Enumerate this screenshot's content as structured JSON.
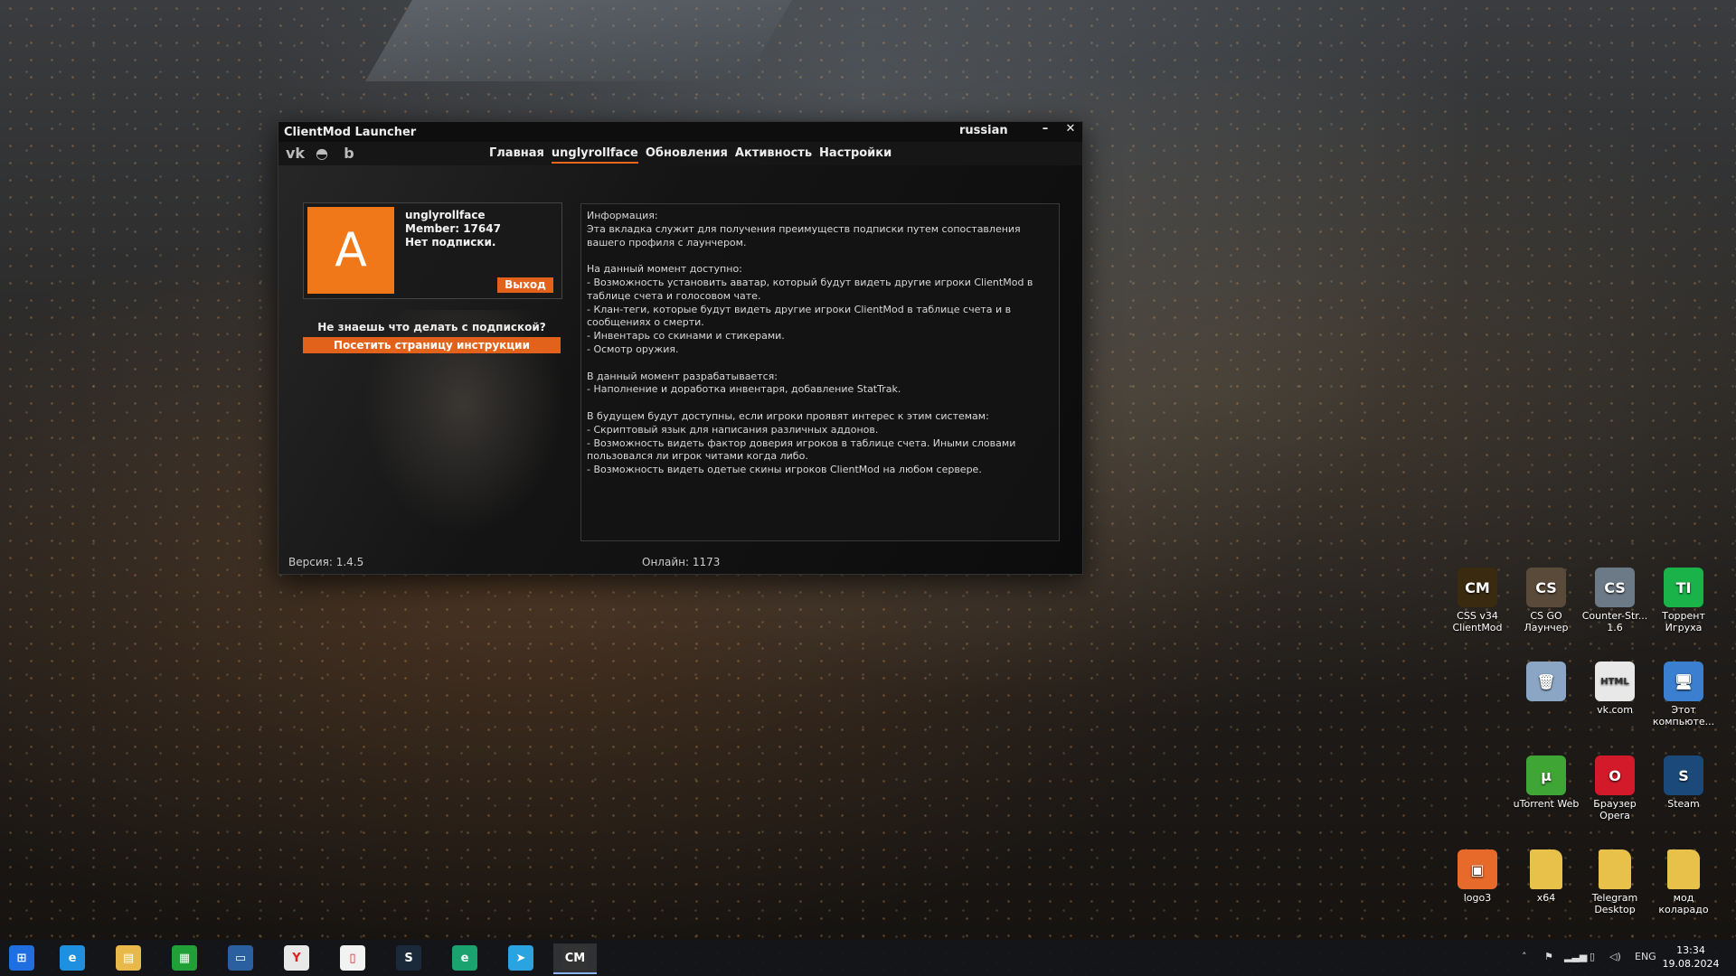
{
  "window": {
    "title": "ClientMod Launcher",
    "language": "russian",
    "minimize_glyph": "–",
    "close_glyph": "✕"
  },
  "social": [
    {
      "icon": "vk-icon",
      "glyph": "vk"
    },
    {
      "icon": "discord-icon",
      "glyph": "◓"
    },
    {
      "icon": "b-logo-icon",
      "glyph": "b"
    }
  ],
  "tabs": [
    {
      "label": "Главная"
    },
    {
      "label": "unglyrollface"
    },
    {
      "label": "Обновления"
    },
    {
      "label": "Активность"
    },
    {
      "label": "Настройки"
    }
  ],
  "profile": {
    "avatar_letter": "A",
    "username": "unglyrollface",
    "member": "Member: 17647",
    "subscription": "Нет подписки.",
    "logout_label": "Выход"
  },
  "help": {
    "question": "Не знаешь что делать с подпиской?",
    "button_label": "Посетить страницу инструкции"
  },
  "info": {
    "text": "Информация:\nЭта вкладка служит для получения преимуществ подписки путем сопоставления вашего профиля с лаунчером.\n\nНа данный момент доступно:\n- Возможность установить аватар, который будут видеть другие игроки ClientMod в таблице счета и голосовом чате.\n- Клан-теги, которые будут видеть другие игроки ClientMod в таблице счета и в сообщениях о смерти.\n- Инвентарь со скинами и стикерами.\n- Осмотр оружия.\n\nВ данный момент разрабатывается:\n- Наполнение и доработка инвентаря, добавление StatTrak.\n\nВ будущем будут доступны, если игроки проявят интерес к этим системам:\n- Скриптовый язык для написания различных аддонов.\n- Возможность видеть фактор доверия игроков в таблице счета. Иными словами пользовался ли игрок читами когда либо.\n- Возможность видеть одетые скины игроков ClientMod на любом сервере."
  },
  "footer": {
    "version": "Версия: 1.4.5",
    "online": "Онлайн: 1173"
  },
  "desktop_icons": [
    {
      "label": "CSS v34 ClientMod",
      "icon": "clientmod-icon",
      "glyph": "CM",
      "color": "#3a2a10"
    },
    {
      "label": "CS GO Лаунчер",
      "icon": "csgo-icon",
      "glyph": "CS",
      "color": "#5a4a3a"
    },
    {
      "label": "Counter-Str... 1.6",
      "icon": "counter-strike-icon",
      "glyph": "CS",
      "color": "#6c7a88"
    },
    {
      "label": "Торрент Игруха",
      "icon": "torrent-igruha-icon",
      "glyph": "TI",
      "color": "#19b34a"
    },
    {
      "label": "",
      "icon": "recycle-bin-icon",
      "glyph": "🗑",
      "color": "#8aa6c4"
    },
    {
      "label": "vk.com",
      "icon": "html-file-icon",
      "glyph": "HTML",
      "color": "#e8e8e8"
    },
    {
      "label": "Этот компьюте...",
      "icon": "this-pc-icon",
      "glyph": "🖥",
      "color": "#3b7fd0"
    },
    {
      "label": "uTorrent Web",
      "icon": "utorrent-icon",
      "glyph": "µ",
      "color": "#3fa535"
    },
    {
      "label": "Браузер Opera",
      "icon": "opera-icon",
      "glyph": "O",
      "color": "#d21a2a"
    },
    {
      "label": "Steam",
      "icon": "steam-icon",
      "glyph": "S",
      "color": "#1b4a7a"
    },
    {
      "label": "logo3",
      "icon": "image-file-icon",
      "glyph": "▣",
      "color": "#e86a2a"
    },
    {
      "label": "x64",
      "icon": "folder-icon",
      "glyph": "",
      "color": "#e8c14a"
    },
    {
      "label": "Telegram Desktop",
      "icon": "folder-icon",
      "glyph": "",
      "color": "#e8c14a"
    },
    {
      "label": "мод коларадо",
      "icon": "folder-icon",
      "glyph": "",
      "color": "#e8c14a"
    }
  ],
  "taskbar": {
    "items": [
      {
        "icon": "windows-start-icon",
        "glyph": "⊞",
        "color": "#1f6fe0"
      },
      {
        "icon": "internet-explorer-icon",
        "glyph": "e",
        "color": "#1f8fe0"
      },
      {
        "icon": "file-explorer-icon",
        "glyph": "▤",
        "color": "#e8b84a"
      },
      {
        "icon": "store-icon",
        "glyph": "▦",
        "color": "#21a038"
      },
      {
        "icon": "monitor-app-icon",
        "glyph": "▭",
        "color": "#2a5fa0"
      },
      {
        "icon": "yandex-browser-icon",
        "glyph": "Y",
        "color": "#e8e8e8"
      },
      {
        "icon": "blank-file-icon",
        "glyph": "▯",
        "color": "#f2f2f2"
      },
      {
        "icon": "steam-taskbar-icon",
        "glyph": "S",
        "color": "#1b2a3a"
      },
      {
        "icon": "edge-icon",
        "glyph": "e",
        "color": "#1aa36e"
      },
      {
        "icon": "telegram-icon",
        "glyph": "➤",
        "color": "#2aa3e0"
      },
      {
        "icon": "clientmod-taskbar-icon",
        "glyph": "CM",
        "color": "#333"
      }
    ],
    "tray_lang": "ENG",
    "time": "13:34",
    "date": "19.08.2024"
  }
}
